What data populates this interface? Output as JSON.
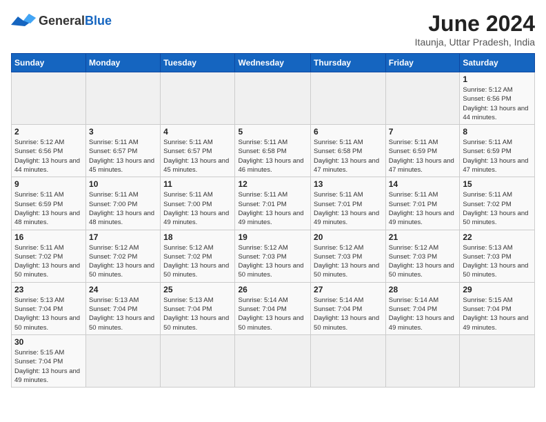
{
  "header": {
    "logo_general": "General",
    "logo_blue": "Blue",
    "title": "June 2024",
    "subtitle": "Itaunja, Uttar Pradesh, India"
  },
  "weekdays": [
    "Sunday",
    "Monday",
    "Tuesday",
    "Wednesday",
    "Thursday",
    "Friday",
    "Saturday"
  ],
  "weeks": [
    [
      {
        "day": "",
        "empty": true
      },
      {
        "day": "",
        "empty": true
      },
      {
        "day": "",
        "empty": true
      },
      {
        "day": "",
        "empty": true
      },
      {
        "day": "",
        "empty": true
      },
      {
        "day": "",
        "empty": true
      },
      {
        "day": "1",
        "sunrise": "5:12 AM",
        "sunset": "6:56 PM",
        "daylight": "13 hours and 44 minutes."
      }
    ],
    [
      {
        "day": "2",
        "sunrise": "5:12 AM",
        "sunset": "6:56 PM",
        "daylight": "13 hours and 44 minutes."
      },
      {
        "day": "3",
        "sunrise": "5:11 AM",
        "sunset": "6:57 PM",
        "daylight": "13 hours and 45 minutes."
      },
      {
        "day": "4",
        "sunrise": "5:11 AM",
        "sunset": "6:57 PM",
        "daylight": "13 hours and 45 minutes."
      },
      {
        "day": "5",
        "sunrise": "5:11 AM",
        "sunset": "6:58 PM",
        "daylight": "13 hours and 46 minutes."
      },
      {
        "day": "6",
        "sunrise": "5:11 AM",
        "sunset": "6:58 PM",
        "daylight": "13 hours and 47 minutes."
      },
      {
        "day": "7",
        "sunrise": "5:11 AM",
        "sunset": "6:59 PM",
        "daylight": "13 hours and 47 minutes."
      },
      {
        "day": "8",
        "sunrise": "5:11 AM",
        "sunset": "6:59 PM",
        "daylight": "13 hours and 47 minutes."
      }
    ],
    [
      {
        "day": "9",
        "sunrise": "5:11 AM",
        "sunset": "6:59 PM",
        "daylight": "13 hours and 48 minutes."
      },
      {
        "day": "10",
        "sunrise": "5:11 AM",
        "sunset": "7:00 PM",
        "daylight": "13 hours and 48 minutes."
      },
      {
        "day": "11",
        "sunrise": "5:11 AM",
        "sunset": "7:00 PM",
        "daylight": "13 hours and 49 minutes."
      },
      {
        "day": "12",
        "sunrise": "5:11 AM",
        "sunset": "7:01 PM",
        "daylight": "13 hours and 49 minutes."
      },
      {
        "day": "13",
        "sunrise": "5:11 AM",
        "sunset": "7:01 PM",
        "daylight": "13 hours and 49 minutes."
      },
      {
        "day": "14",
        "sunrise": "5:11 AM",
        "sunset": "7:01 PM",
        "daylight": "13 hours and 49 minutes."
      },
      {
        "day": "15",
        "sunrise": "5:11 AM",
        "sunset": "7:02 PM",
        "daylight": "13 hours and 50 minutes."
      }
    ],
    [
      {
        "day": "16",
        "sunrise": "5:11 AM",
        "sunset": "7:02 PM",
        "daylight": "13 hours and 50 minutes."
      },
      {
        "day": "17",
        "sunrise": "5:12 AM",
        "sunset": "7:02 PM",
        "daylight": "13 hours and 50 minutes."
      },
      {
        "day": "18",
        "sunrise": "5:12 AM",
        "sunset": "7:02 PM",
        "daylight": "13 hours and 50 minutes."
      },
      {
        "day": "19",
        "sunrise": "5:12 AM",
        "sunset": "7:03 PM",
        "daylight": "13 hours and 50 minutes."
      },
      {
        "day": "20",
        "sunrise": "5:12 AM",
        "sunset": "7:03 PM",
        "daylight": "13 hours and 50 minutes."
      },
      {
        "day": "21",
        "sunrise": "5:12 AM",
        "sunset": "7:03 PM",
        "daylight": "13 hours and 50 minutes."
      },
      {
        "day": "22",
        "sunrise": "5:13 AM",
        "sunset": "7:03 PM",
        "daylight": "13 hours and 50 minutes."
      }
    ],
    [
      {
        "day": "23",
        "sunrise": "5:13 AM",
        "sunset": "7:04 PM",
        "daylight": "13 hours and 50 minutes."
      },
      {
        "day": "24",
        "sunrise": "5:13 AM",
        "sunset": "7:04 PM",
        "daylight": "13 hours and 50 minutes."
      },
      {
        "day": "25",
        "sunrise": "5:13 AM",
        "sunset": "7:04 PM",
        "daylight": "13 hours and 50 minutes."
      },
      {
        "day": "26",
        "sunrise": "5:14 AM",
        "sunset": "7:04 PM",
        "daylight": "13 hours and 50 minutes."
      },
      {
        "day": "27",
        "sunrise": "5:14 AM",
        "sunset": "7:04 PM",
        "daylight": "13 hours and 50 minutes."
      },
      {
        "day": "28",
        "sunrise": "5:14 AM",
        "sunset": "7:04 PM",
        "daylight": "13 hours and 49 minutes."
      },
      {
        "day": "29",
        "sunrise": "5:15 AM",
        "sunset": "7:04 PM",
        "daylight": "13 hours and 49 minutes."
      }
    ],
    [
      {
        "day": "30",
        "sunrise": "5:15 AM",
        "sunset": "7:04 PM",
        "daylight": "13 hours and 49 minutes."
      },
      {
        "day": "",
        "empty": true
      },
      {
        "day": "",
        "empty": true
      },
      {
        "day": "",
        "empty": true
      },
      {
        "day": "",
        "empty": true
      },
      {
        "day": "",
        "empty": true
      },
      {
        "day": "",
        "empty": true
      }
    ]
  ]
}
